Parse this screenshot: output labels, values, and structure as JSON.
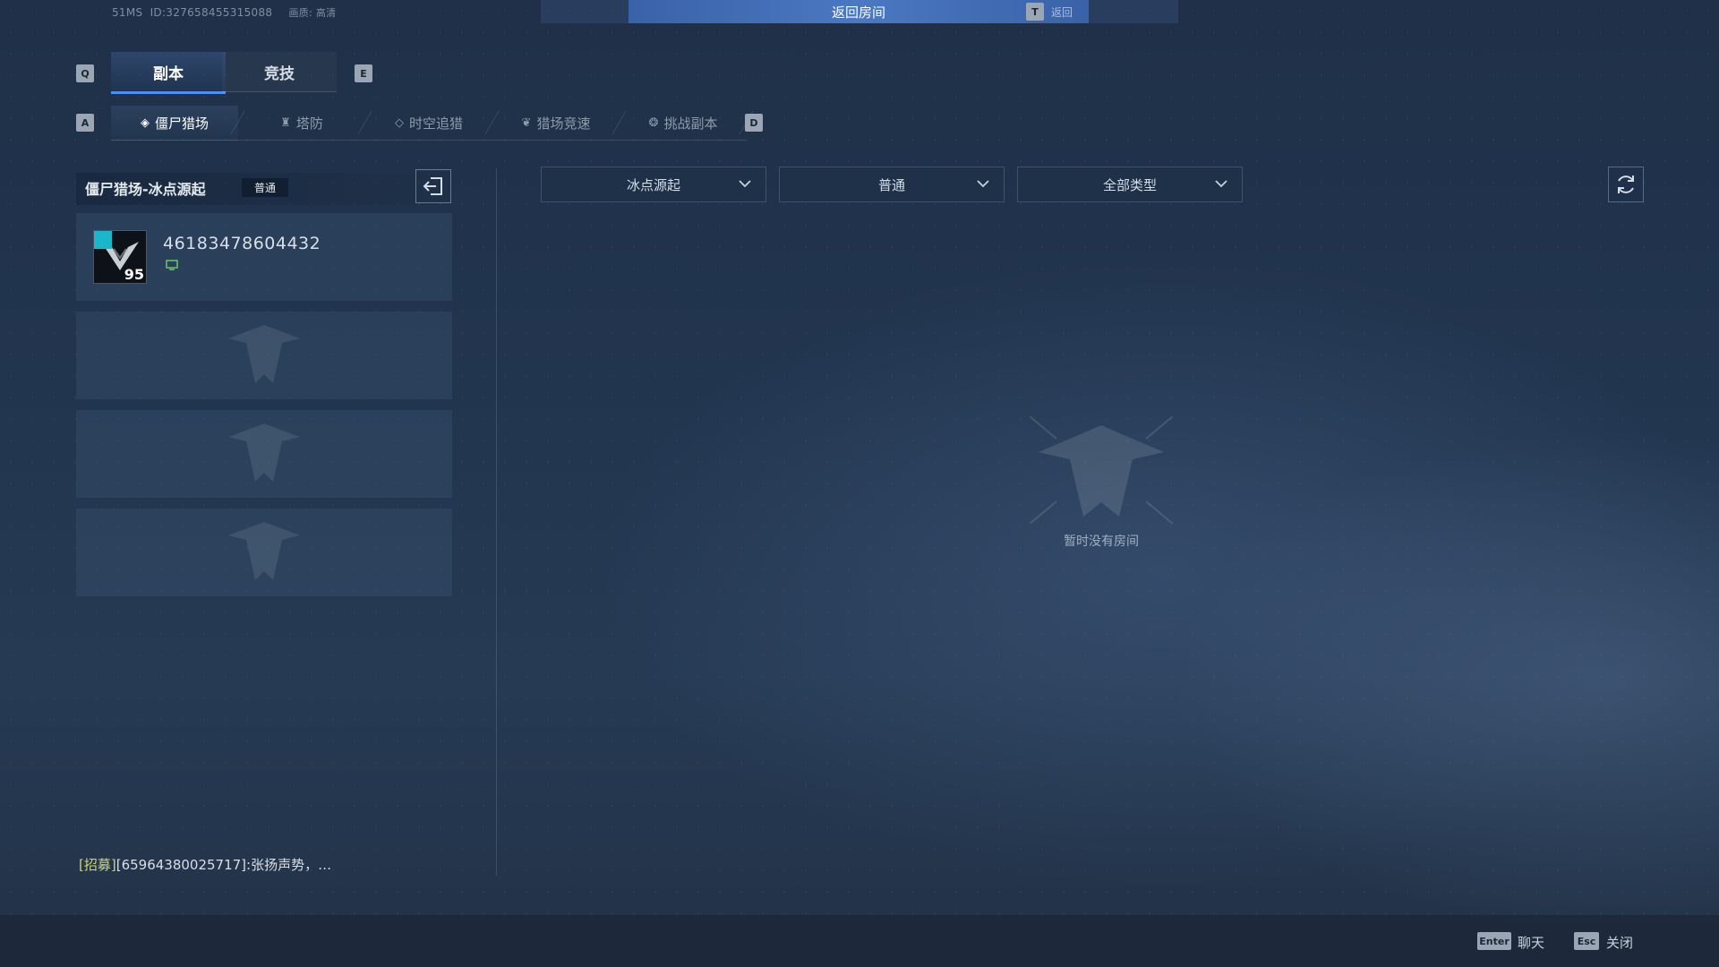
{
  "topbar": {
    "ms": "51MS",
    "id_text": "ID:327658455315088",
    "quality_text": "画质: 高清",
    "return_room": "返回房间",
    "return_key": "T",
    "return_hint": "返回"
  },
  "main_tabs": {
    "prev_key": "Q",
    "next_key": "E",
    "items": [
      {
        "label": "副本",
        "active": true
      },
      {
        "label": "竞技",
        "active": false
      }
    ]
  },
  "sub_tabs": {
    "prev_key": "A",
    "next_key": "D",
    "items": [
      {
        "label": "僵尸猎场",
        "icon": "zombie-hunt-icon",
        "active": true
      },
      {
        "label": "塔防",
        "icon": "tower-defense-icon",
        "active": false
      },
      {
        "label": "时空追猎",
        "icon": "time-hunt-icon",
        "active": false
      },
      {
        "label": "猎场竞速",
        "icon": "speed-hunt-icon",
        "active": false
      },
      {
        "label": "挑战副本",
        "icon": "challenge-icon",
        "active": false
      }
    ]
  },
  "room_panel": {
    "title": "僵尸猎场-冰点源起",
    "difficulty": "普通",
    "player": {
      "id": "46183478604432",
      "level": "95"
    }
  },
  "filters": {
    "map": "冰点源起",
    "difficulty": "普通",
    "type": "全部类型"
  },
  "empty_state": {
    "text": "暂时没有房间"
  },
  "recruit": {
    "tag": "[招募]",
    "message": "[65964380025717]:张扬声势，…"
  },
  "bottom": {
    "enter_key": "Enter",
    "enter_label": "聊天",
    "esc_key": "Esc",
    "esc_label": "关闭"
  },
  "colors": {
    "accent": "#4d8ef0",
    "return_bar": "#4a78c2",
    "flag": "#19b7c9",
    "recruit_tag": "#c9d57a"
  }
}
